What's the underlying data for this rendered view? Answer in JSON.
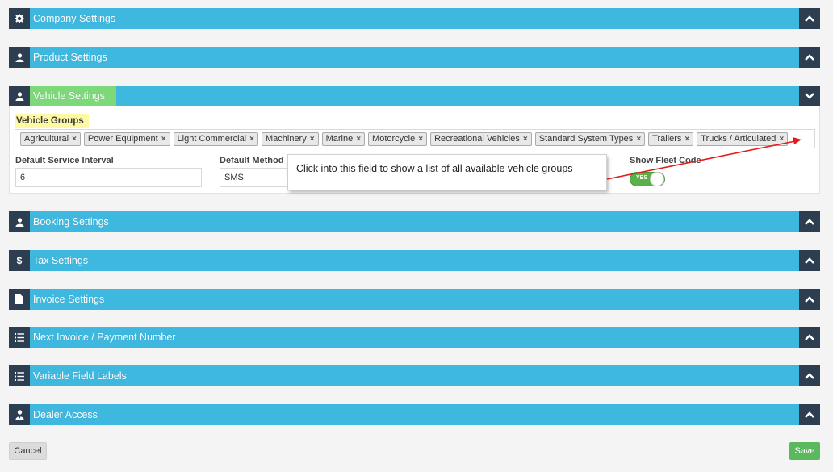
{
  "panels": [
    {
      "title": "Company Settings",
      "icon": "gear-icon",
      "toggle": "chevron-up"
    },
    {
      "title": "Product Settings",
      "icon": "user-icon",
      "toggle": "chevron-up"
    },
    {
      "title": "Vehicle Settings",
      "icon": "user-icon",
      "toggle": "chevron-down"
    },
    {
      "title": "Booking Settings",
      "icon": "user-icon",
      "toggle": "chevron-up"
    },
    {
      "title": "Tax Settings",
      "icon": "dollar-icon",
      "toggle": "chevron-up"
    },
    {
      "title": "Invoice Settings",
      "icon": "file-icon",
      "toggle": "chevron-up"
    },
    {
      "title": "Next Invoice / Payment Number",
      "icon": "list-icon",
      "toggle": "chevron-up"
    },
    {
      "title": "Variable Field Labels",
      "icon": "list-icon",
      "toggle": "chevron-up"
    },
    {
      "title": "Dealer Access",
      "icon": "user-tie-icon",
      "toggle": "chevron-up"
    }
  ],
  "vehicle": {
    "groups_label": "Vehicle Groups",
    "tags": [
      "Agricultural",
      "Power Equipment",
      "Light Commercial",
      "Machinery",
      "Marine",
      "Motorcycle",
      "Recreational Vehicles",
      "Standard System Types",
      "Trailers",
      "Trucks / Articulated"
    ],
    "service_interval_label": "Default Service Interval",
    "service_interval_value": "6",
    "method_label": "Default Method C",
    "method_value": "SMS",
    "fleet_code_label": "Show Fleet Code",
    "fleet_code_switch": "YES"
  },
  "callout_text": "Click into this field to show a list of all available vehicle groups",
  "buttons": {
    "cancel": "Cancel",
    "save": "Save"
  },
  "colors": {
    "bar": "#3fb8e0",
    "icon_bg": "#2c3e50",
    "highlight": "#7dd87a",
    "save": "#5cb85c"
  }
}
